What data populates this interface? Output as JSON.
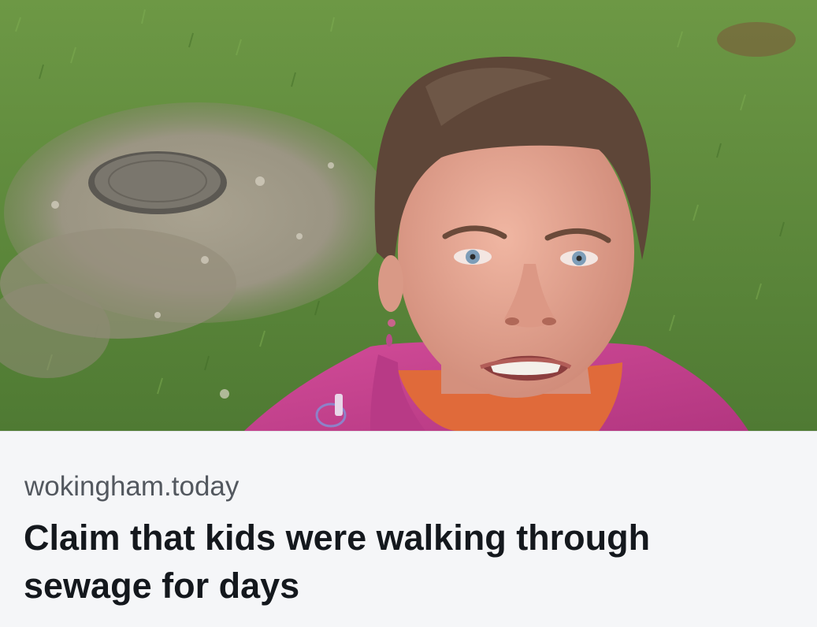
{
  "link_card": {
    "image": {
      "description_icon": "photo-image",
      "colors": {
        "grass": "#5f8a3e",
        "mud": "#9b9583",
        "jacket": "#c9408f",
        "hair": "#5e4638",
        "skin": "#e3a08d"
      }
    },
    "domain": "wokingham.today",
    "headline": "Claim that kids were walking through sewage for days"
  }
}
